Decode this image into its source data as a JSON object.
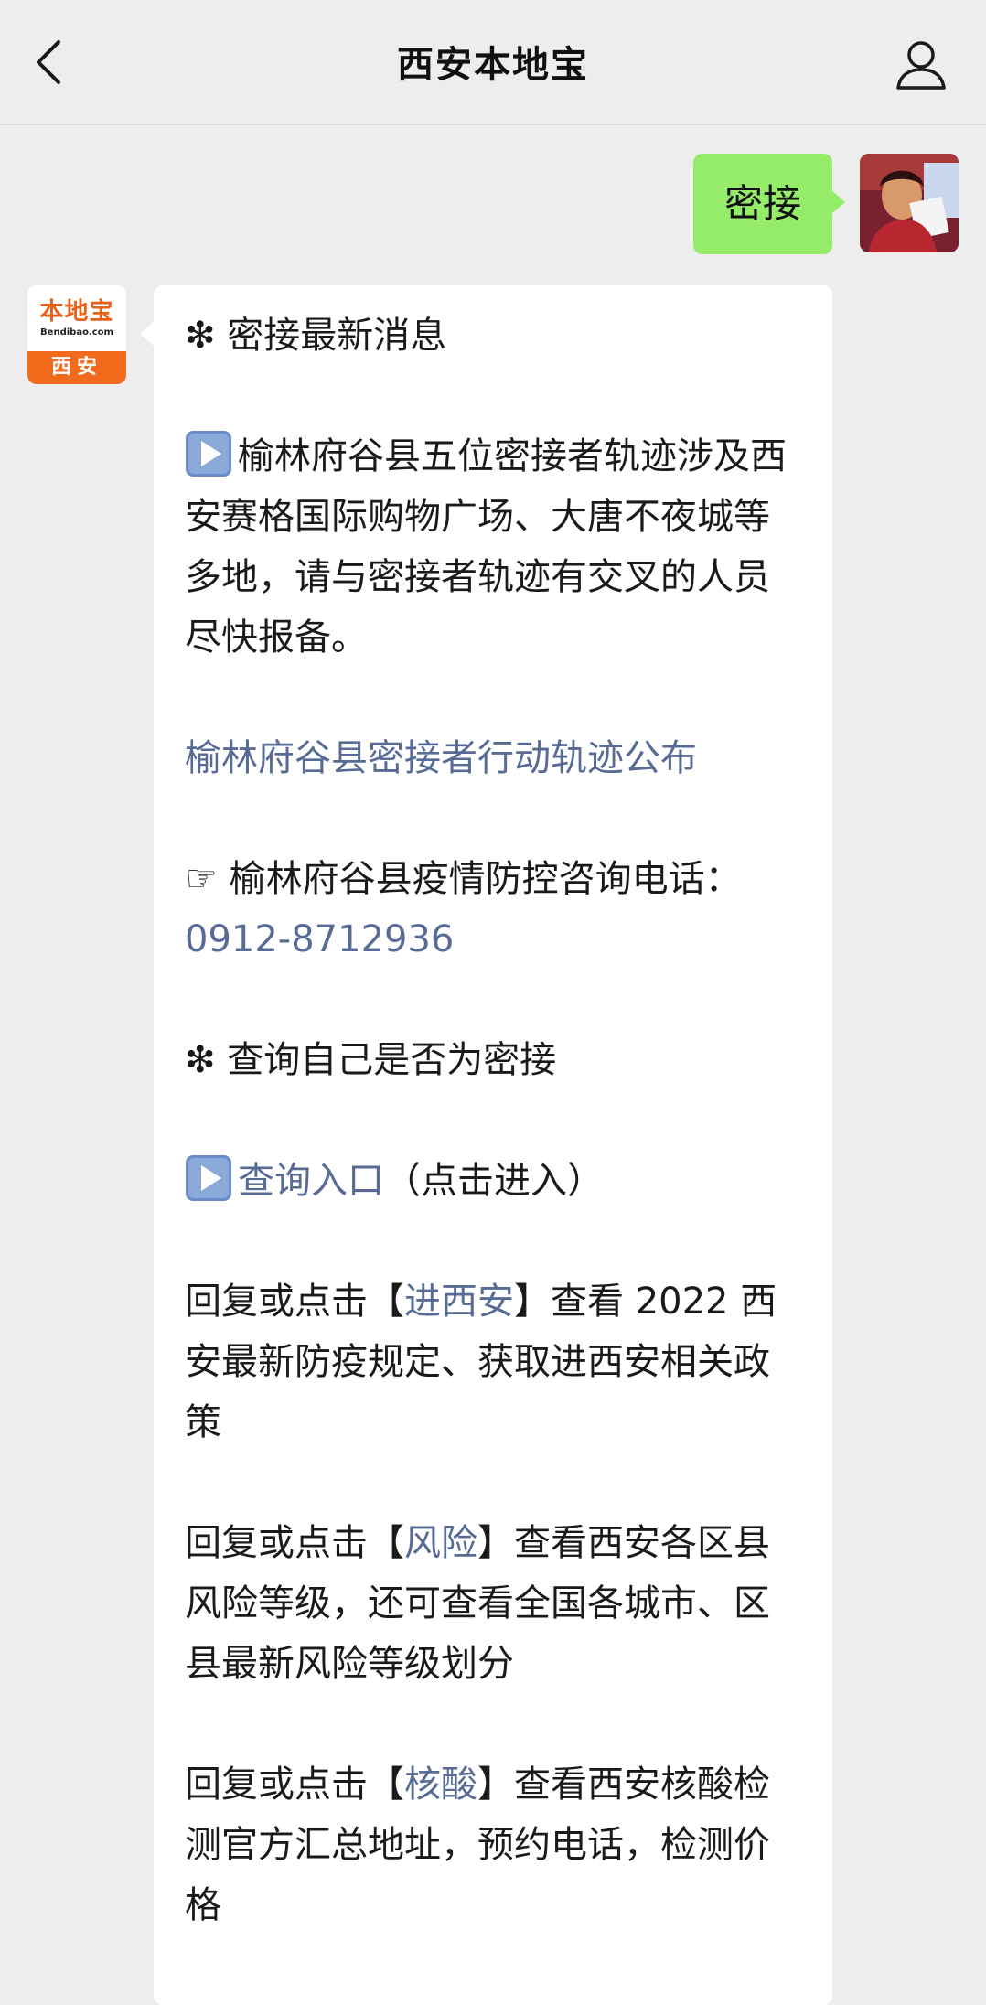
{
  "header": {
    "title": "西安本地宝",
    "back_icon": "chevron-left-icon",
    "profile_icon": "person-icon"
  },
  "outgoing": {
    "text": "密接",
    "bubble_color": "#95ec69"
  },
  "account_logo": {
    "main": "本地宝",
    "sub": "Bendibao.com",
    "city": "西安",
    "accent": "#f26b1d"
  },
  "message": {
    "p1": "❇ 密接最新消息",
    "p2": "榆林府谷县五位密接者轨迹涉及西安赛格国际购物广场、大唐不夜城等多地，请与密接者轨迹有交叉的人员尽快报备。",
    "p3_link": "榆林府谷县密接者行动轨迹公布",
    "p4": "☞ 榆林府谷县疫情防控咨询电话：",
    "p4_phone": "0912-8712936",
    "p5": "❇ 查询自己是否为密接",
    "p6_link": "查询入口",
    "p6_rest": "（点击进入）",
    "r1_pre": "回复或点击【",
    "r1_link": "进西安",
    "r1_post": "】查看 2022 西安最新防疫规定、获取进西安相关政策",
    "r2_pre": "回复或点击【",
    "r2_link": "风险",
    "r2_post": "】查看西安各区县风险等级，还可查看全国各城市、区县最新风险等级划分",
    "r3_pre": "回复或点击【",
    "r3_link": "核酸",
    "r3_post": "】查看西安核酸检测官方汇总地址，预约电话，检测价格",
    "link_color": "#576b95"
  }
}
